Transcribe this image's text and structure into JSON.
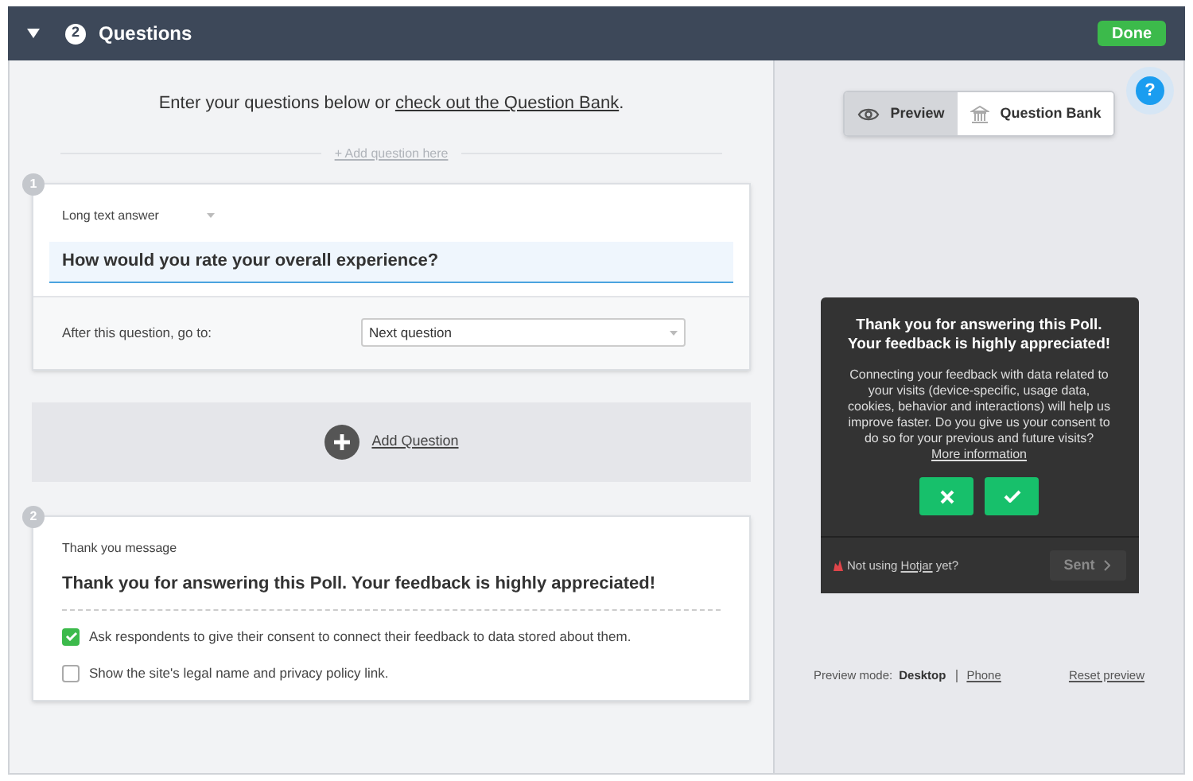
{
  "header": {
    "step": "2",
    "title": "Questions",
    "expanded": true,
    "done": "Done"
  },
  "intro": {
    "text": "Enter your questions below or ",
    "link": "check out the Question Bank",
    "end": "."
  },
  "add_here": "+ Add question here",
  "questions": [
    {
      "number": "1",
      "type": "Long text answer",
      "question": "How would you rate your overall experience?",
      "logic_label": "After this question, go to:",
      "logic_value": "Next question"
    }
  ],
  "add_question": "Add Question",
  "thank_you": {
    "number": "2",
    "label": "Thank you message",
    "message": "Thank you for answering this Poll. Your feedback is highly appreciated!",
    "options": [
      {
        "label": "Ask respondents to give their consent to connect their feedback to data stored about them.",
        "checked": true
      },
      {
        "label": "Show the site's legal name and privacy policy link.",
        "checked": false
      }
    ]
  },
  "preview_tabs": [
    {
      "label": "Preview",
      "kind": "eye",
      "selected": true
    },
    {
      "label": "Question Bank",
      "kind": "bank",
      "selected": false
    }
  ],
  "help": "?",
  "widget": {
    "title": "Thank you for answering this Poll. Your feedback is highly appreciated!",
    "body": "Connecting your feedback with data related to your visits (device-specific, usage data, cookies, behavior and interactions) will help us improve faster. Do you give us your consent to do so for your previous and future visits? ",
    "more": "More information",
    "footer_pre": "Not using ",
    "footer_link": "Hotjar",
    "footer_post": " yet?",
    "send": "Sent",
    "send_disabled": true
  },
  "preview_mode": {
    "label": "Preview mode:",
    "options": [
      {
        "label": "Desktop",
        "selected": true
      },
      {
        "label": "Phone",
        "selected": false
      }
    ],
    "reset": "Reset preview"
  }
}
